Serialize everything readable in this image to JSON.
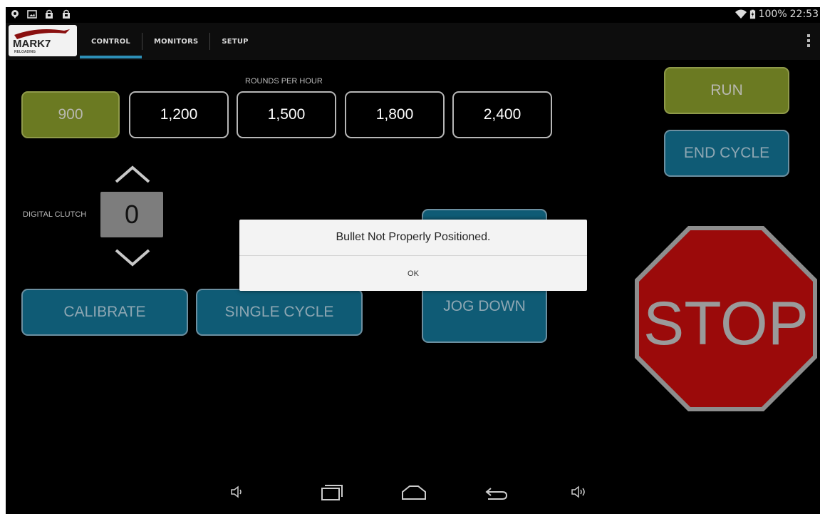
{
  "status_bar": {
    "notification_icons": [
      "chat-bubble-icon",
      "image-icon",
      "shopping-bag-icon",
      "shopping-bag-icon"
    ],
    "battery": "100%",
    "time": "22:53"
  },
  "action_bar": {
    "logo_text": "MARK7",
    "logo_subtext": "RELOADING",
    "tabs": [
      {
        "label": "CONTROL",
        "active": true
      },
      {
        "label": "MONITORS",
        "active": false
      },
      {
        "label": "SETUP",
        "active": false
      }
    ]
  },
  "control": {
    "rounds_per_hour_label": "ROUNDS PER HOUR",
    "rate_options": [
      "900",
      "1,200",
      "1,500",
      "1,800",
      "2,400"
    ],
    "selected_rate": "900",
    "run_label": "RUN",
    "end_cycle_label": "END CYCLE",
    "digital_clutch_label": "DIGITAL CLUTCH",
    "clutch_value": "0",
    "calibrate_label": "CALIBRATE",
    "single_cycle_label": "SINGLE CYCLE",
    "jog_down_label": "JOG DOWN",
    "stop_label": "STOP"
  },
  "dialog": {
    "message": "Bullet Not Properly Positioned.",
    "ok_label": "OK"
  },
  "colors": {
    "green_button": "#6b7a22",
    "blue_button": "#0f5b75",
    "stop_red": "#9b0a0a",
    "tab_indicator": "#2d8fb7"
  }
}
